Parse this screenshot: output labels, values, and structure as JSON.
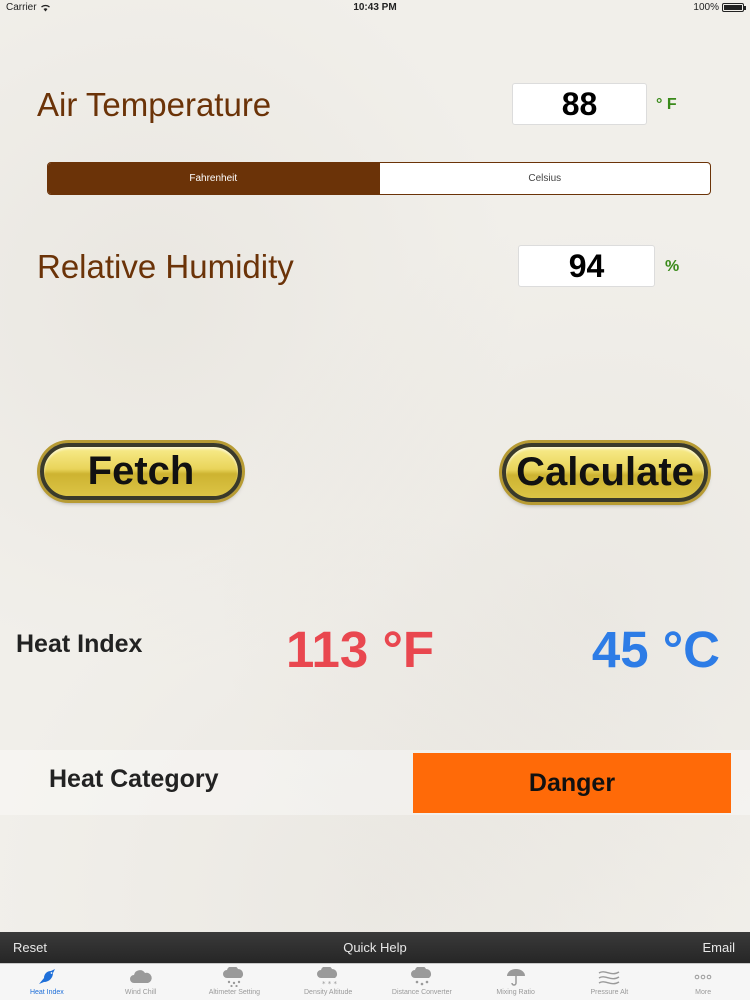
{
  "status_bar": {
    "carrier": "Carrier",
    "time": "10:43 PM",
    "battery": "100%"
  },
  "air_temperature": {
    "label": "Air Temperature",
    "value": "88",
    "unit": "° F"
  },
  "unit_selector": {
    "options": [
      "Fahrenheit",
      "Celsius"
    ],
    "selected": "Fahrenheit"
  },
  "relative_humidity": {
    "label": "Relative Humidity",
    "value": "94",
    "unit": "%"
  },
  "buttons": {
    "fetch": "Fetch",
    "calculate": "Calculate"
  },
  "heat_index": {
    "label": "Heat Index",
    "fahrenheit": "113 °F",
    "celsius": "45 °C"
  },
  "heat_category": {
    "label": "Heat Category",
    "value": "Danger",
    "color": "#ff6a08"
  },
  "toolbar": {
    "reset": "Reset",
    "quick_help": "Quick Help",
    "email": "Email"
  },
  "tabs": [
    {
      "label": "Heat Index",
      "icon": "bird-icon",
      "active": true
    },
    {
      "label": "Wind Chill",
      "icon": "cloud-icon",
      "active": false
    },
    {
      "label": "Altimeter Setting",
      "icon": "cloud-rain-icon",
      "active": false
    },
    {
      "label": "Density Altitude",
      "icon": "cloud-snow-icon",
      "active": false
    },
    {
      "label": "Distance Converter",
      "icon": "cloud-storm-icon",
      "active": false
    },
    {
      "label": "Mixing Ratio",
      "icon": "umbrella-icon",
      "active": false
    },
    {
      "label": "Pressure Alt",
      "icon": "wind-icon",
      "active": false
    },
    {
      "label": "More",
      "icon": "more-icon",
      "active": false
    }
  ],
  "colors": {
    "label_brown": "#6b3308",
    "unit_green": "#3a8a1a",
    "heat_f_red": "#e9474f",
    "heat_c_blue": "#2d7ce6",
    "tab_active_blue": "#1e6fd9"
  }
}
